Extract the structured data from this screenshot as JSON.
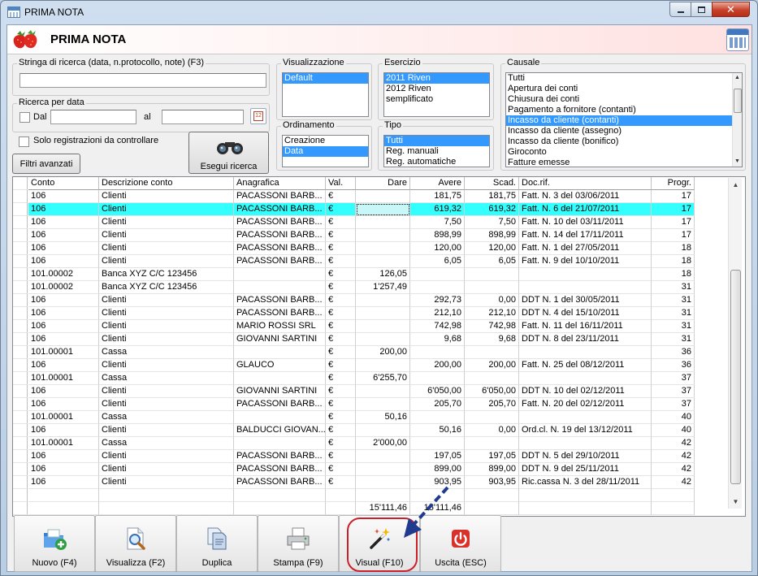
{
  "window": {
    "title": "PRIMA NOTA"
  },
  "header": {
    "title": "PRIMA NOTA"
  },
  "search": {
    "legend": "Stringa di ricerca (data, n.protocollo, note) (F3)",
    "value": ""
  },
  "date_search": {
    "legend": "Ricerca per data",
    "from_label": "Dal",
    "to_label": "al",
    "from_value": "",
    "to_value": ""
  },
  "only_check_label": "Solo registrazioni da controllare",
  "advanced_filters_label": "Filtri avanzati",
  "run_search_label": "Esegui ricerca",
  "view": {
    "legend": "Visualizzazione",
    "items": [
      "Default"
    ],
    "selected": 0
  },
  "sort": {
    "legend": "Ordinamento",
    "items": [
      "Creazione",
      "Data"
    ],
    "selected": 1
  },
  "year": {
    "legend": "Esercizio",
    "items": [
      "2011 Riven",
      "2012 Riven",
      "semplificato"
    ],
    "selected": 0
  },
  "type": {
    "legend": "Tipo",
    "items": [
      "Tutti",
      "Reg. manuali",
      "Reg. automatiche"
    ],
    "selected": 0
  },
  "causale": {
    "legend": "Causale",
    "items": [
      "Tutti",
      "Apertura dei conti",
      "Chiusura dei conti",
      "Pagamento a fornitore (contanti)",
      "Incasso da cliente (contanti)",
      "Incasso da cliente (assegno)",
      "Incasso da cliente (bonifico)",
      "Giroconto",
      "Fatture emesse"
    ],
    "selected": 4
  },
  "table": {
    "headers": [
      "Conto",
      "Descrizione conto",
      "Anagrafica",
      "Val.",
      "Dare",
      "Avere",
      "Scad.",
      "Doc.rif.",
      "Progr."
    ],
    "selected_row": 1,
    "rows": [
      [
        "106",
        "Clienti",
        "PACASSONI BARB...",
        "€",
        "",
        "181,75",
        "181,75",
        "Fatt. N. 3 del 03/06/2011",
        "17"
      ],
      [
        "106",
        "Clienti",
        "PACASSONI BARB...",
        "€",
        "",
        "619,32",
        "619,32",
        "Fatt. N. 6 del 21/07/2011",
        "17"
      ],
      [
        "106",
        "Clienti",
        "PACASSONI BARB...",
        "€",
        "",
        "7,50",
        "7,50",
        "Fatt. N. 10 del 03/11/2011",
        "17"
      ],
      [
        "106",
        "Clienti",
        "PACASSONI BARB...",
        "€",
        "",
        "898,99",
        "898,99",
        "Fatt. N. 14 del 17/11/2011",
        "17"
      ],
      [
        "106",
        "Clienti",
        "PACASSONI BARB...",
        "€",
        "",
        "120,00",
        "120,00",
        "Fatt. N. 1 del 27/05/2011",
        "18"
      ],
      [
        "106",
        "Clienti",
        "PACASSONI BARB...",
        "€",
        "",
        "6,05",
        "6,05",
        "Fatt. N. 9 del 10/10/2011",
        "18"
      ],
      [
        "101.00002",
        "Banca XYZ C/C 123456",
        "",
        "€",
        "126,05",
        "",
        "",
        "",
        "18"
      ],
      [
        "101.00002",
        "Banca XYZ C/C 123456",
        "",
        "€",
        "1'257,49",
        "",
        "",
        "",
        "31"
      ],
      [
        "106",
        "Clienti",
        "PACASSONI BARB...",
        "€",
        "",
        "292,73",
        "0,00",
        "DDT N. 1 del 30/05/2011",
        "31"
      ],
      [
        "106",
        "Clienti",
        "PACASSONI BARB...",
        "€",
        "",
        "212,10",
        "212,10",
        "DDT N. 4 del 15/10/2011",
        "31"
      ],
      [
        "106",
        "Clienti",
        "MARIO ROSSI SRL",
        "€",
        "",
        "742,98",
        "742,98",
        "Fatt. N. 11 del 16/11/2011",
        "31"
      ],
      [
        "106",
        "Clienti",
        "GIOVANNI SARTINI",
        "€",
        "",
        "9,68",
        "9,68",
        "DDT N. 8 del 23/11/2011",
        "31"
      ],
      [
        "101.00001",
        "Cassa",
        "",
        "€",
        "200,00",
        "",
        "",
        "",
        "36"
      ],
      [
        "106",
        "Clienti",
        "GLAUCO",
        "€",
        "",
        "200,00",
        "200,00",
        "Fatt. N. 25 del 08/12/2011",
        "36"
      ],
      [
        "101.00001",
        "Cassa",
        "",
        "€",
        "6'255,70",
        "",
        "",
        "",
        "37"
      ],
      [
        "106",
        "Clienti",
        "GIOVANNI SARTINI",
        "€",
        "",
        "6'050,00",
        "6'050,00",
        "DDT N. 10 del 02/12/2011",
        "37"
      ],
      [
        "106",
        "Clienti",
        "PACASSONI BARB...",
        "€",
        "",
        "205,70",
        "205,70",
        "Fatt. N. 20 del 02/12/2011",
        "37"
      ],
      [
        "101.00001",
        "Cassa",
        "",
        "€",
        "50,16",
        "",
        "",
        "",
        "40"
      ],
      [
        "106",
        "Clienti",
        "BALDUCCI GIOVAN...",
        "€",
        "",
        "50,16",
        "0,00",
        "Ord.cl. N. 19 del 13/12/2011",
        "40"
      ],
      [
        "101.00001",
        "Cassa",
        "",
        "€",
        "2'000,00",
        "",
        "",
        "",
        "42"
      ],
      [
        "106",
        "Clienti",
        "PACASSONI BARB...",
        "€",
        "",
        "197,05",
        "197,05",
        "DDT N. 5 del 29/10/2011",
        "42"
      ],
      [
        "106",
        "Clienti",
        "PACASSONI BARB...",
        "€",
        "",
        "899,00",
        "899,00",
        "DDT N. 9 del 25/11/2011",
        "42"
      ],
      [
        "106",
        "Clienti",
        "PACASSONI BARB...",
        "€",
        "",
        "903,95",
        "903,95",
        "Ric.cassa N. 3 del 28/11/2011",
        "42"
      ],
      [
        "",
        "",
        "",
        "",
        "",
        "",
        "",
        "",
        ""
      ]
    ],
    "totals": [
      "",
      "",
      "",
      "",
      "15'111,46",
      "15'111,46",
      "",
      "",
      ""
    ]
  },
  "toolbar": [
    {
      "name": "new-button",
      "icon": "folder-add-icon",
      "label": "Nuovo (F4)"
    },
    {
      "name": "view-button",
      "icon": "magnifier-page-icon",
      "label": "Visualizza (F2)"
    },
    {
      "name": "duplicate-button",
      "icon": "copy-pages-icon",
      "label": "Duplica"
    },
    {
      "name": "print-button",
      "icon": "printer-icon",
      "label": "Stampa (F9)"
    },
    {
      "name": "visual-button",
      "icon": "magic-wand-icon",
      "label": "Visual (F10)"
    },
    {
      "name": "exit-button",
      "icon": "power-icon",
      "label": "Uscita (ESC)"
    }
  ],
  "colors": {
    "selection": "#3399ff",
    "selected_row": "#33ffff",
    "annotation_circle": "#cc1f2a",
    "annotation_arrow": "#1f3a8f"
  }
}
